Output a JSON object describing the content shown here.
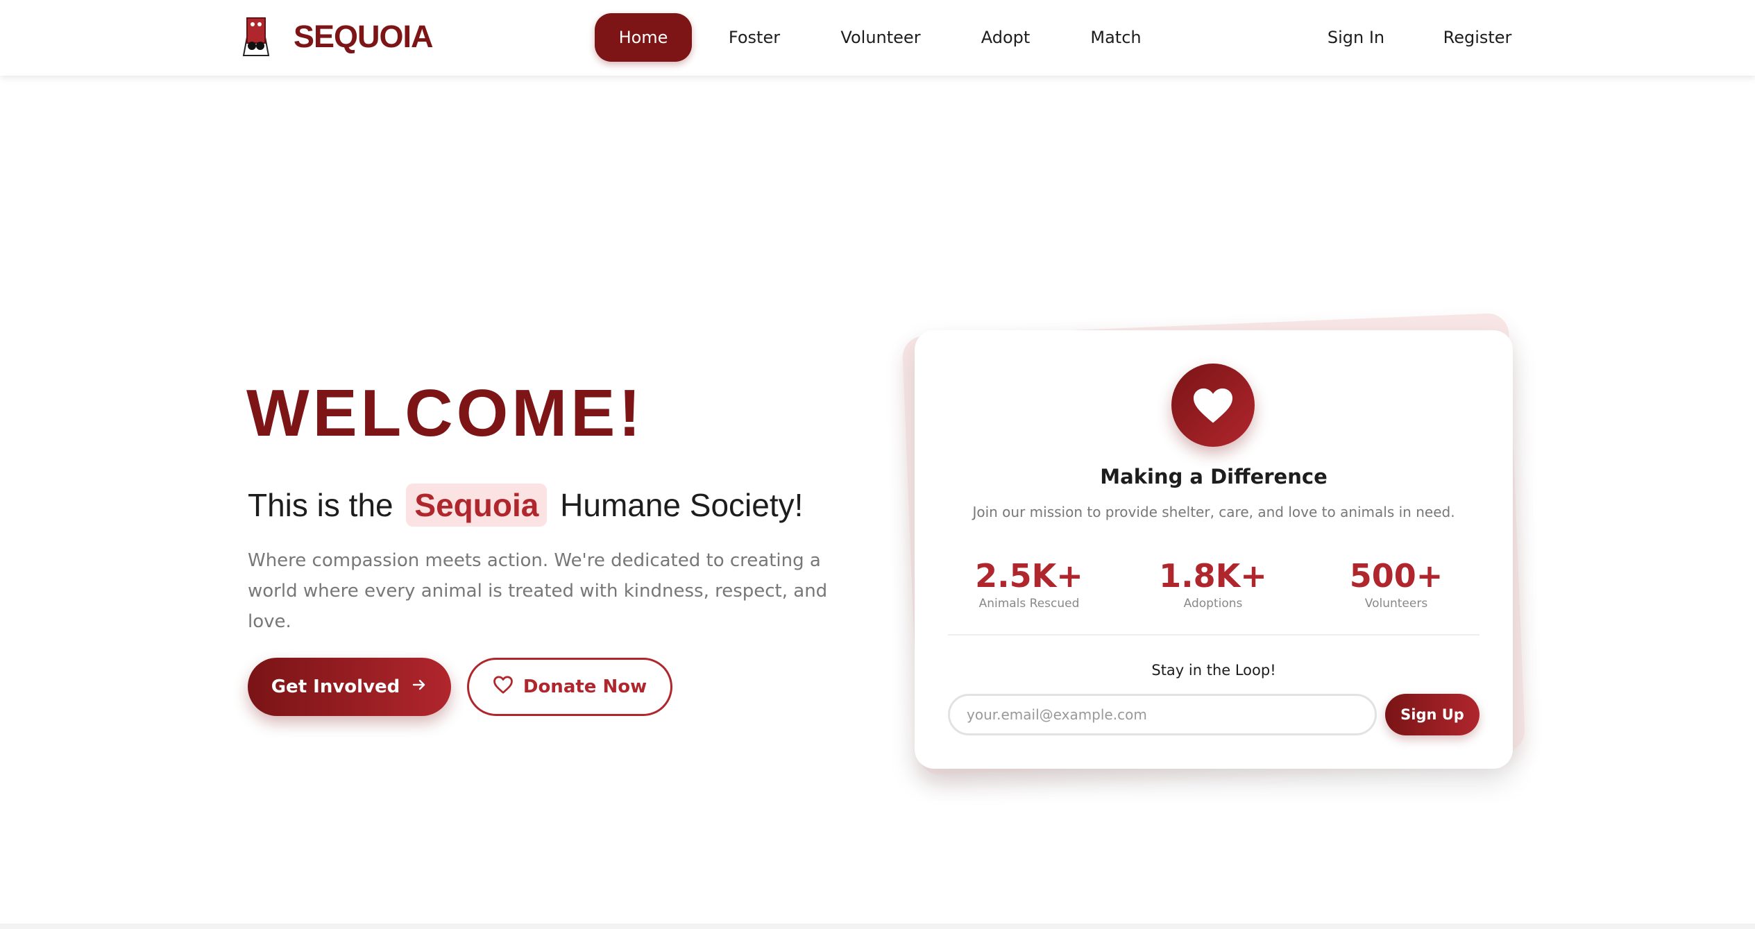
{
  "brand": {
    "name": "SEQUOIA",
    "logo_icon": "sequoia-logo-icon"
  },
  "nav": {
    "items": [
      {
        "label": "Home",
        "active": true
      },
      {
        "label": "Foster"
      },
      {
        "label": "Volunteer"
      },
      {
        "label": "Adopt"
      },
      {
        "label": "Match"
      }
    ],
    "auth": [
      {
        "label": "Sign In"
      },
      {
        "label": "Register"
      }
    ]
  },
  "hero": {
    "heading": "WELCOME!",
    "subtitle_before": "This is the",
    "subtitle_highlight": "Sequoia",
    "subtitle_after": "Humane Society!",
    "description": "Where compassion meets action. We're dedicated to creating a world where every animal is treated with kindness, respect, and love.",
    "primary_button": {
      "label": "Get Involved",
      "icon": "arrow-right-icon"
    },
    "secondary_button": {
      "label": "Donate Now",
      "icon": "heart-outline-icon"
    }
  },
  "card": {
    "icon": "heart-icon",
    "title": "Making a Difference",
    "description": "Join our mission to provide shelter, care, and love to animals in need.",
    "stats": [
      {
        "value": "2.5K+",
        "label": "Animals Rescued"
      },
      {
        "value": "1.8K+",
        "label": "Adoptions"
      },
      {
        "value": "500+",
        "label": "Volunteers"
      }
    ],
    "newsletter": {
      "title": "Stay in the Loop!",
      "placeholder": "your.email@example.com",
      "value": "",
      "button": "Sign Up"
    }
  },
  "colors": {
    "brand": "#7d1416",
    "accent": "#b0262d",
    "highlight_bg": "#fbe3e3"
  }
}
